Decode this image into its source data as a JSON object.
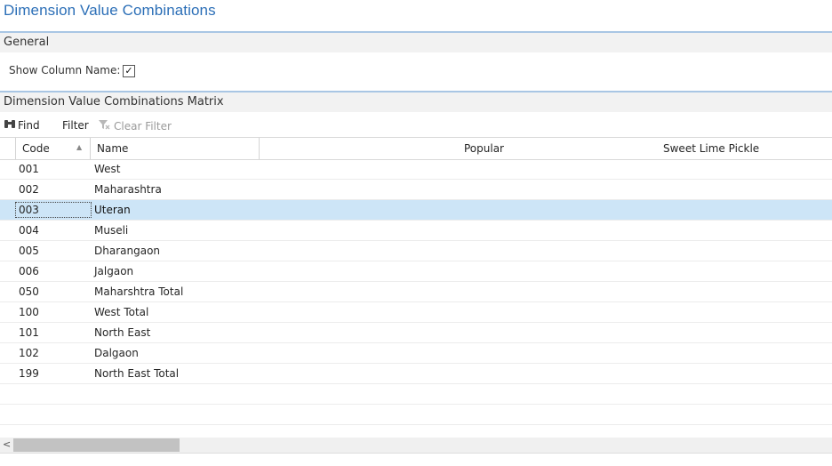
{
  "page": {
    "title": "Dimension Value Combinations"
  },
  "general": {
    "header": "General",
    "show_column_name_label": "Show Column Name:",
    "show_column_name_checked": true,
    "checkmark": "✓"
  },
  "matrix": {
    "header": "Dimension Value Combinations Matrix",
    "toolbar": {
      "find_label": "Find",
      "find_icon": "binoculars-icon",
      "filter_label": "Filter",
      "clear_filter_label": "Clear Filter",
      "clear_filter_icon": "clear-filter-icon"
    },
    "columns": {
      "code": "Code",
      "name": "Name",
      "col1": "Popular",
      "col2": "Sweet Lime Pickle"
    },
    "rows": [
      {
        "code": "001",
        "name": "West"
      },
      {
        "code": "002",
        "name": "Maharashtra"
      },
      {
        "code": "003",
        "name": "Uteran"
      },
      {
        "code": "004",
        "name": "Museli"
      },
      {
        "code": "005",
        "name": "Dharangaon"
      },
      {
        "code": "006",
        "name": "Jalgaon"
      },
      {
        "code": "050",
        "name": "Maharshtra Total"
      },
      {
        "code": "100",
        "name": "West Total"
      },
      {
        "code": "101",
        "name": "North East"
      },
      {
        "code": "102",
        "name": "Dalgaon"
      },
      {
        "code": "199",
        "name": "North East Total"
      }
    ],
    "selected_row_index": 2
  },
  "colors": {
    "title": "#2c6fb7",
    "selected_row": "#cde5f7",
    "section_border": "#a9c6e4"
  }
}
